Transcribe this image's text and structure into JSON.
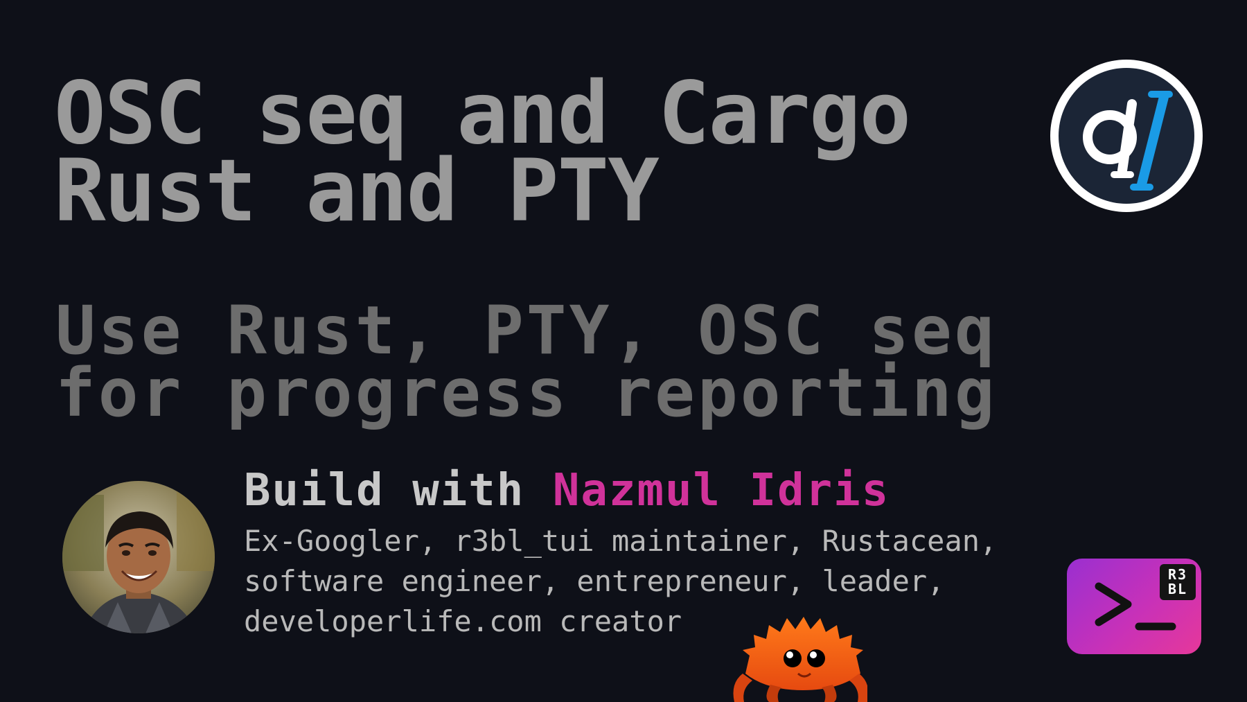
{
  "title": {
    "line1": "OSC seq and Cargo",
    "line2": "Rust and PTY"
  },
  "subtitle": {
    "line1": "Use Rust, PTY, OSC seq",
    "line2": "for progress reporting"
  },
  "byline": {
    "prefix": "Build with",
    "name": "Nazmul Idris"
  },
  "bio": {
    "line1": "Ex-Googler, r3bl_tui maintainer, Rustacean,",
    "line2": "software engineer, entrepreneur, leader,",
    "line3": "developerlife.com creator"
  },
  "logos": {
    "developerlife": "dl",
    "r3bl_line1": "R3",
    "r3bl_line2": "BL"
  },
  "colors": {
    "background": "#0e1018",
    "title": "#9a9a9a",
    "subtitle": "#6d6d6d",
    "name_accent": "#d0329a",
    "dl_accent": "#1a9be6"
  }
}
